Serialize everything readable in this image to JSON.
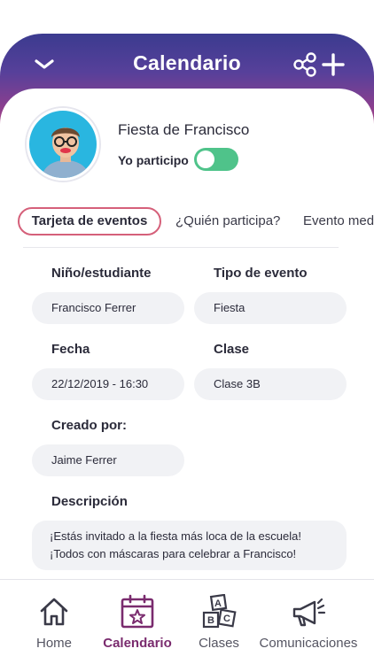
{
  "header": {
    "title": "Calendario",
    "back_icon": "chevron-down-icon",
    "share_icon": "share-icon",
    "add_icon": "plus-icon"
  },
  "event": {
    "title": "Fiesta de Francisco",
    "participate_label": "Yo participo",
    "participating": true
  },
  "tabs": [
    {
      "label": "Tarjeta de eventos",
      "active": true
    },
    {
      "label": "¿Quién participa?",
      "active": false
    },
    {
      "label": "Evento med",
      "active": false
    }
  ],
  "fields": {
    "student": {
      "label": "Niño/estudiante",
      "value": "Francisco Ferrer"
    },
    "event_type": {
      "label": "Tipo de evento",
      "value": "Fiesta"
    },
    "date": {
      "label": "Fecha",
      "value": "22/12/2019 - 16:30"
    },
    "class": {
      "label": "Clase",
      "value": "Clase 3B"
    },
    "created_by": {
      "label": "Creado por:",
      "value": "Jaime Ferrer"
    },
    "description": {
      "label": "Descripción",
      "line1": "¡Estás invitado a la fiesta más loca de la escuela!",
      "line2": "¡Todos con máscaras para celebrar a Francisco!"
    }
  },
  "nav": [
    {
      "label": "Home",
      "icon": "home-icon",
      "active": false
    },
    {
      "label": "Calendario",
      "icon": "calendar-icon",
      "active": true
    },
    {
      "label": "Clases",
      "icon": "blocks-icon",
      "active": false
    },
    {
      "label": "Comunicaciones",
      "icon": "megaphone-icon",
      "active": false
    }
  ],
  "colors": {
    "header_top": "#3b3b8f",
    "header_bottom": "#b2457f",
    "toggle_on": "#4fc38a",
    "active_tab_border": "#d5607a",
    "nav_active": "#7a2b6e"
  }
}
